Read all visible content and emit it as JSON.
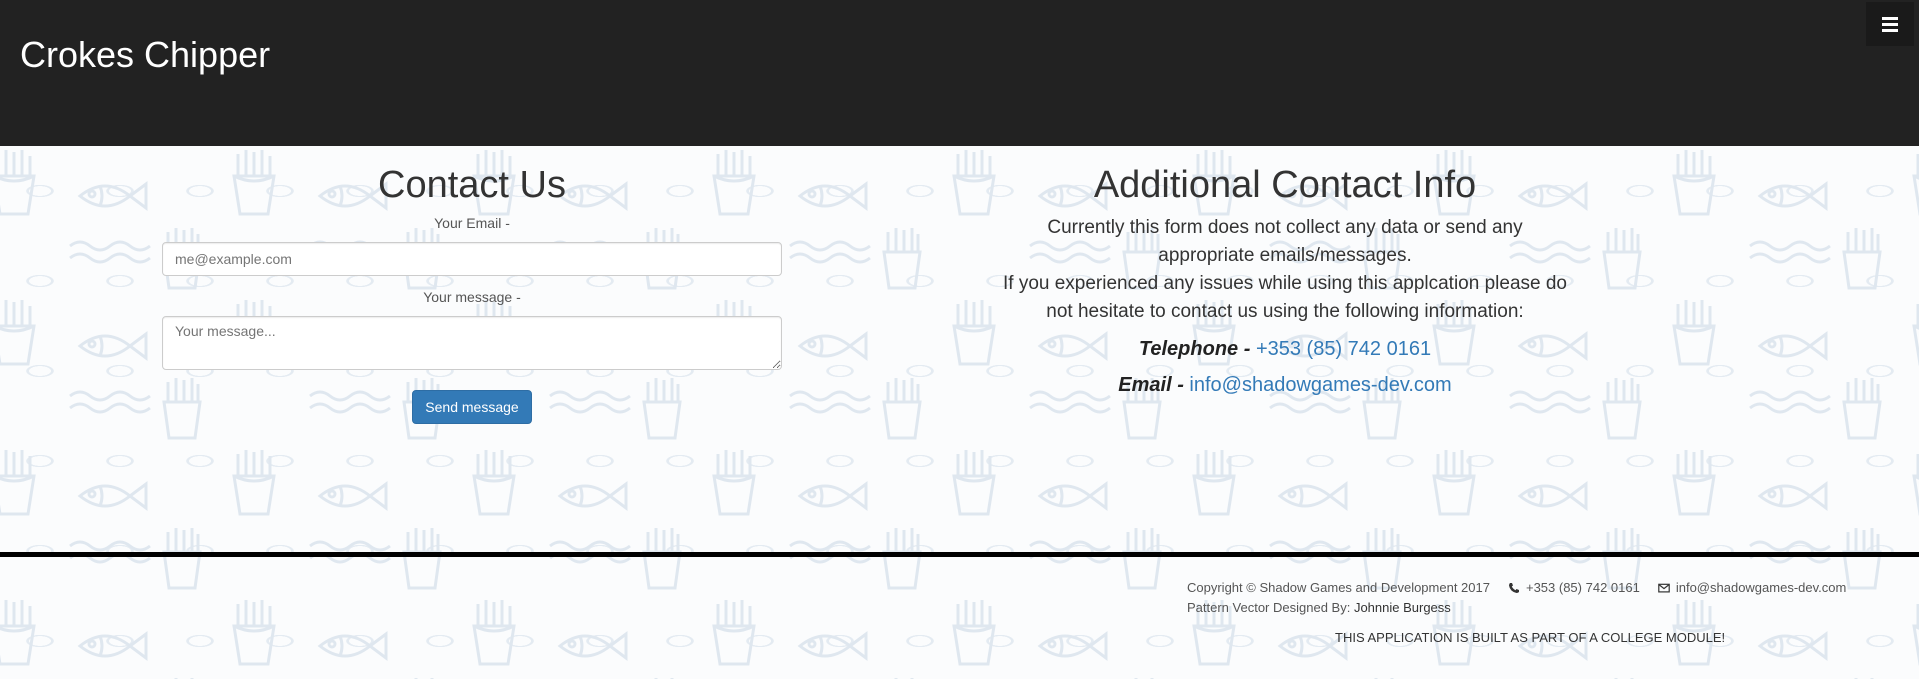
{
  "navbar": {
    "brand": "Crokes Chipper",
    "menu_icon": "hamburger-menu-icon"
  },
  "contact_form": {
    "title": "Contact Us",
    "email_label": "Your Email -",
    "email_placeholder": "me@example.com",
    "message_label": "Your message -",
    "message_placeholder": "Your message...",
    "send_label": "Send message"
  },
  "additional_info": {
    "title": "Additional Contact Info",
    "paragraph1": "Currently this form does not collect any data or send any appropriate emails/messages.",
    "paragraph2": "If you experienced any issues while using this applcation please do not hesitate to contact us using the following information:",
    "telephone_key": "Telephone -",
    "telephone_value": "+353 (85) 742 0161",
    "email_key": "Email -",
    "email_value": "info@shadowgames-dev.com"
  },
  "footer": {
    "copyright": "Copyright © Shadow Games and Development 2017",
    "phone": "+353 (85) 742 0161",
    "email": "info@shadowgames-dev.com",
    "designer_label": "Pattern Vector Designed By:",
    "designer_name": "Johnnie Burgess",
    "note": "THIS APPLICATION IS BUILT AS PART OF A COLLEGE MODULE!",
    "phone_icon": "phone-icon",
    "email_icon": "envelope-icon"
  },
  "colors": {
    "navbar_bg": "#222222",
    "accent": "#337ab7",
    "pattern": "#e4ebf2"
  }
}
